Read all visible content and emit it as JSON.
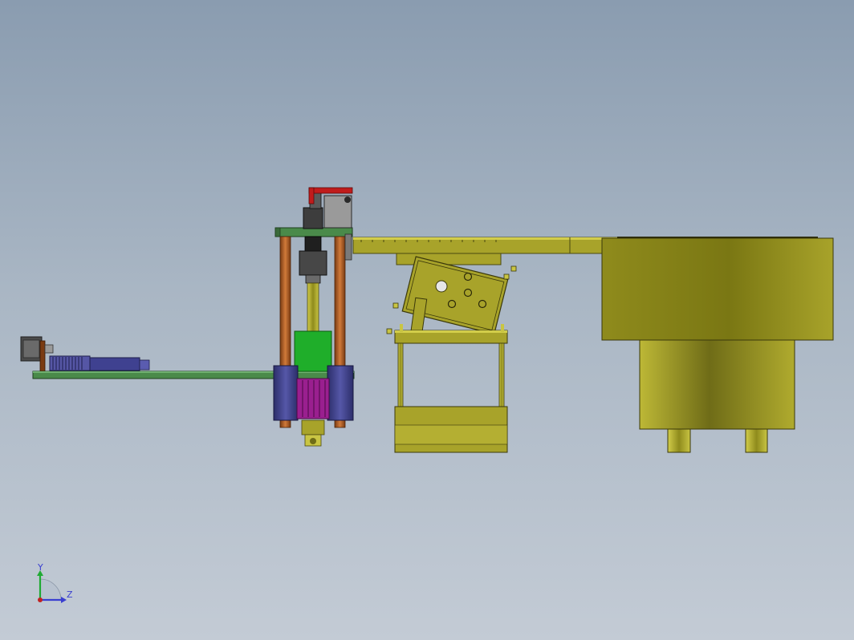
{
  "triad": {
    "y_label": "Y",
    "z_label": "Z"
  },
  "colors": {
    "background_top": "#8a9cb0",
    "background_bottom": "#c3cbd5",
    "olive": "#a8a32a",
    "olive_light": "#c9c543",
    "olive_dark": "#6f6c17",
    "green_plate": "#4a8a4a",
    "copper_rod": "#b8632a",
    "navy": "#3d3f86",
    "magenta": "#9a1f8f",
    "bright_green": "#1fae2a",
    "red_handle": "#c01c1c",
    "grey": "#8a8a8a",
    "dark_grey": "#3b3b3b",
    "triad_y": "#1faa33",
    "triad_z": "#3a3fd0",
    "triad_origin": "#c02222"
  }
}
